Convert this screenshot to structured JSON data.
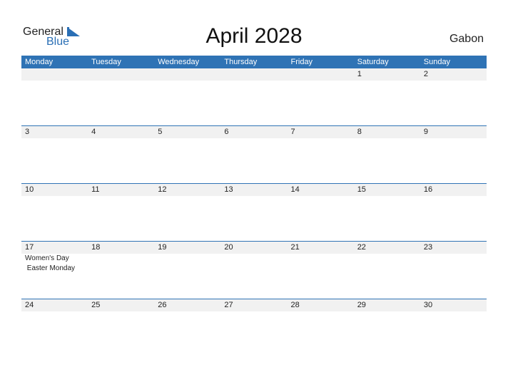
{
  "logo": {
    "general": "General",
    "blue": "Blue"
  },
  "title": "April 2028",
  "country": "Gabon",
  "colors": {
    "accent": "#2f73b5",
    "row_shade": "#f1f1f1"
  },
  "weekdays": [
    "Monday",
    "Tuesday",
    "Wednesday",
    "Thursday",
    "Friday",
    "Saturday",
    "Sunday"
  ],
  "weeks": [
    [
      {
        "day": ""
      },
      {
        "day": ""
      },
      {
        "day": ""
      },
      {
        "day": ""
      },
      {
        "day": ""
      },
      {
        "day": "1"
      },
      {
        "day": "2"
      }
    ],
    [
      {
        "day": "3"
      },
      {
        "day": "4"
      },
      {
        "day": "5"
      },
      {
        "day": "6"
      },
      {
        "day": "7"
      },
      {
        "day": "8"
      },
      {
        "day": "9"
      }
    ],
    [
      {
        "day": "10"
      },
      {
        "day": "11"
      },
      {
        "day": "12"
      },
      {
        "day": "13"
      },
      {
        "day": "14"
      },
      {
        "day": "15"
      },
      {
        "day": "16"
      }
    ],
    [
      {
        "day": "17",
        "events": [
          "Women's Day",
          " Easter Monday"
        ]
      },
      {
        "day": "18"
      },
      {
        "day": "19"
      },
      {
        "day": "20"
      },
      {
        "day": "21"
      },
      {
        "day": "22"
      },
      {
        "day": "23"
      }
    ],
    [
      {
        "day": "24"
      },
      {
        "day": "25"
      },
      {
        "day": "26"
      },
      {
        "day": "27"
      },
      {
        "day": "28"
      },
      {
        "day": "29"
      },
      {
        "day": "30"
      }
    ]
  ]
}
